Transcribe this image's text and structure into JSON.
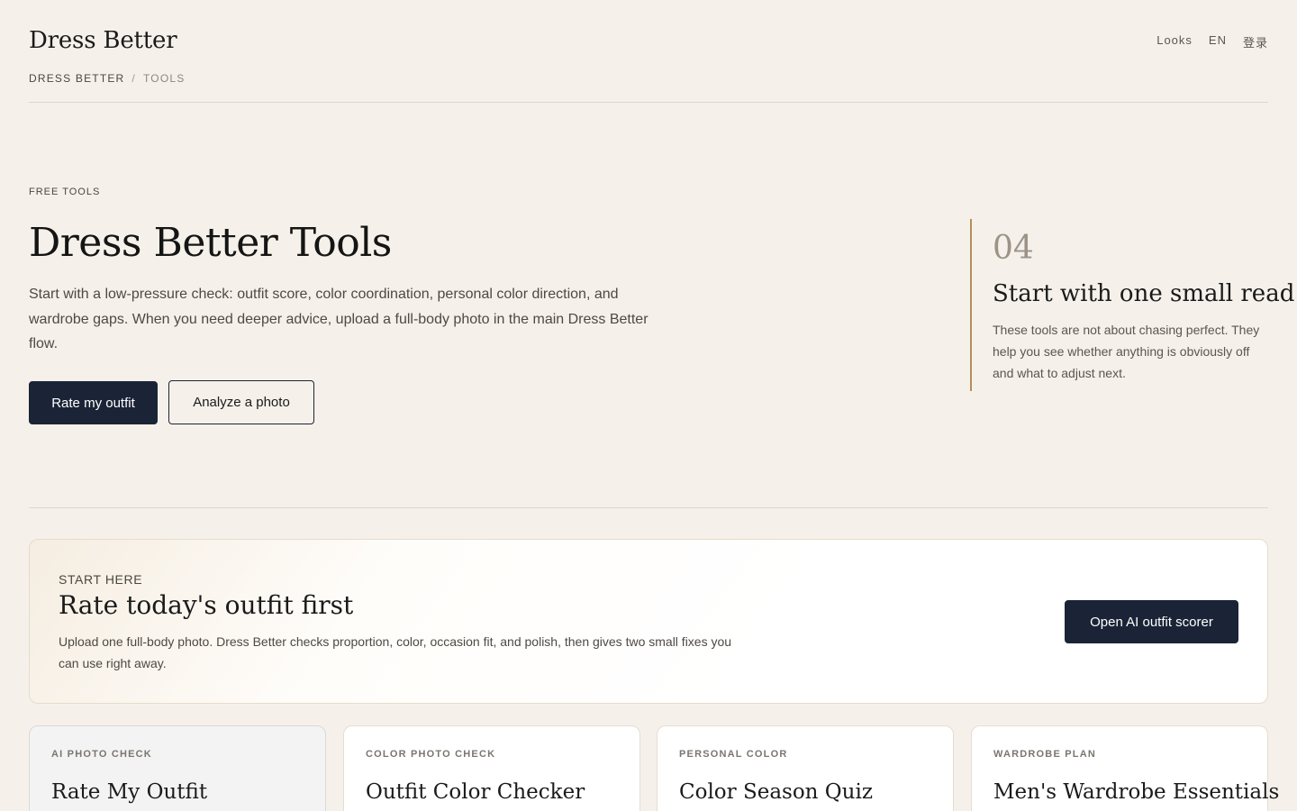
{
  "header": {
    "brand": "Dress Better",
    "nav": [
      "Looks",
      "EN",
      "登录"
    ],
    "breadcrumb": {
      "root": "DRESS BETTER",
      "separator": "/",
      "current": "TOOLS"
    }
  },
  "hero": {
    "eyebrow": "FREE TOOLS",
    "title": "Dress Better Tools",
    "description": "Start with a low-pressure check: outfit score, color coordination, personal color direction, and wardrobe gaps. When you need deeper advice, upload a full-body photo in the main Dress Better flow.",
    "primary_button": "Rate my outfit",
    "secondary_button": "Analyze a photo"
  },
  "aside": {
    "number": "04",
    "title": "Start with one small read",
    "description": "These tools are not about chasing perfect. They help you see whether anything is obviously off and what to adjust next."
  },
  "start_card": {
    "eyebrow": "START HERE",
    "title": "Rate today's outfit first",
    "description": "Upload one full-body photo. Dress Better checks proportion, color, occasion fit, and polish, then gives two small fixes you can use right away.",
    "button": "Open AI outfit scorer"
  },
  "tools": [
    {
      "eyebrow": "AI PHOTO CHECK",
      "title": "Rate My Outfit"
    },
    {
      "eyebrow": "COLOR PHOTO CHECK",
      "title": "Outfit Color Checker"
    },
    {
      "eyebrow": "PERSONAL COLOR",
      "title": "Color Season Quiz"
    },
    {
      "eyebrow": "WARDROBE PLAN",
      "title": "Men's Wardrobe Essentials"
    }
  ],
  "colors": {
    "background": "#f5f1ea",
    "primary_button": "#1b2437",
    "accent_rule": "#b58e5a"
  }
}
